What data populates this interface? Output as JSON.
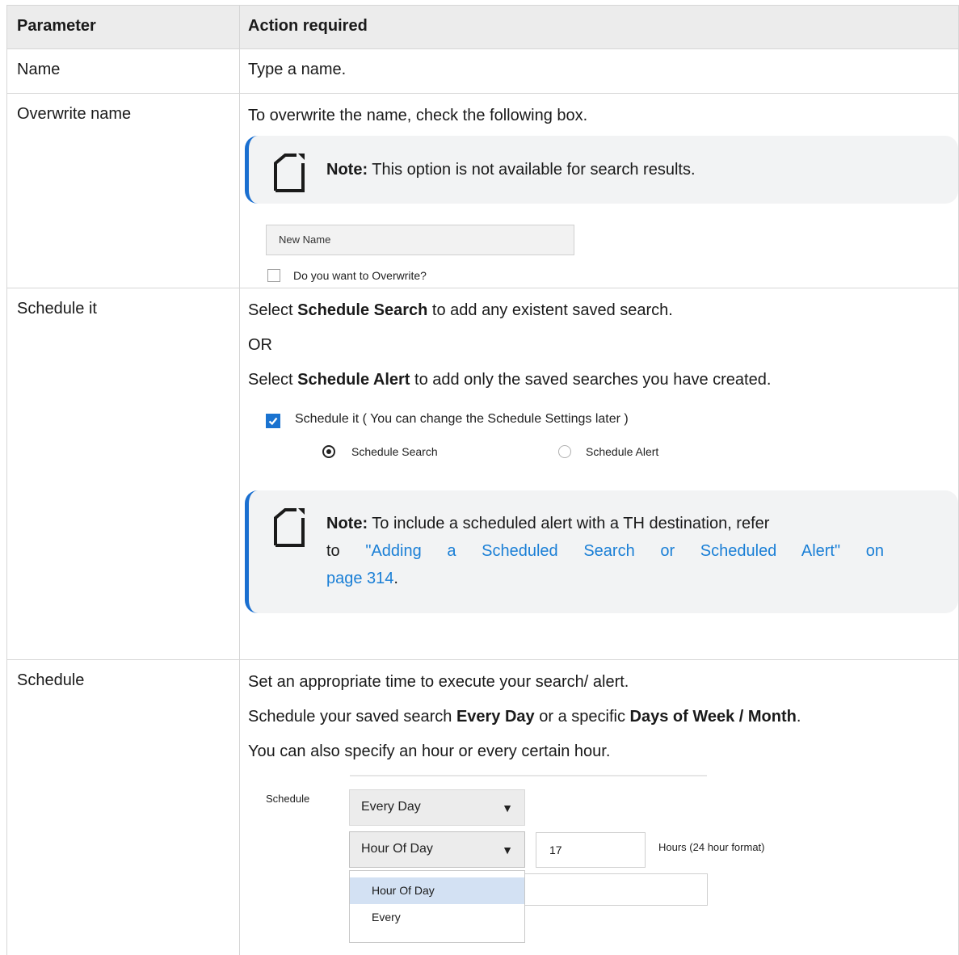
{
  "table": {
    "headers": [
      "Parameter",
      "Action required"
    ]
  },
  "rows": {
    "name": {
      "param": "Name",
      "action": "Type a name."
    },
    "overwrite": {
      "param": "Overwrite name",
      "action": "To overwrite the name, check the following box.",
      "note_label": "Note:",
      "note_text": " This option is not available for search results.",
      "field_value": "New Name",
      "checkbox_label": "Do you want to Overwrite?"
    },
    "schedule_it": {
      "param": "Schedule it",
      "line1_a": "Select ",
      "line1_b": "Schedule Search",
      "line1_c": " to add any existent saved search.",
      "or": "OR",
      "line2_a": "Select ",
      "line2_b": "Schedule Alert",
      "line2_c": " to add only the saved searches you have created.",
      "checkbox_label": "Schedule it ( You can change the Schedule Settings later )",
      "radio_search": "Schedule Search",
      "radio_alert": "Schedule Alert",
      "note_label": "Note:",
      "note_text_1": " To include a scheduled alert with a TH destination, refer",
      "note_text_2_pre": "to ",
      "note_link": "\"Adding a Scheduled Search or Scheduled Alert\" on page 314",
      "note_link_1": "\"Adding  a  Scheduled  Search  or  Scheduled  Alert\"  on",
      "note_link_2": "page 314",
      "note_end": "."
    },
    "schedule": {
      "param": "Schedule",
      "line1": "Set an appropriate time to execute your search/ alert.",
      "line2_a": "Schedule your saved search ",
      "line2_b": "Every Day",
      "line2_c": " or a specific ",
      "line2_d": "Days of Week / Month",
      "line2_e": ".",
      "line3": "You can also specify an hour or every certain hour.",
      "ui_label": "Schedule",
      "select_frequency": "Every Day",
      "select_hour_mode": "Hour Of Day",
      "hour_value": "17",
      "hour_hint": "Hours (24 hour format)",
      "dropdown_options": [
        "Hour Of Day",
        "Every"
      ],
      "arrow": "▼"
    }
  },
  "colors": {
    "accent": "#1a6fd0",
    "link": "#1a7fd6",
    "header_bg": "#ececec",
    "note_bg": "#f2f3f4"
  },
  "icons": {
    "note": "note-pad-icon",
    "checkbox_checked": "checkmark-icon",
    "dropdown": "triangle-down-icon"
  }
}
